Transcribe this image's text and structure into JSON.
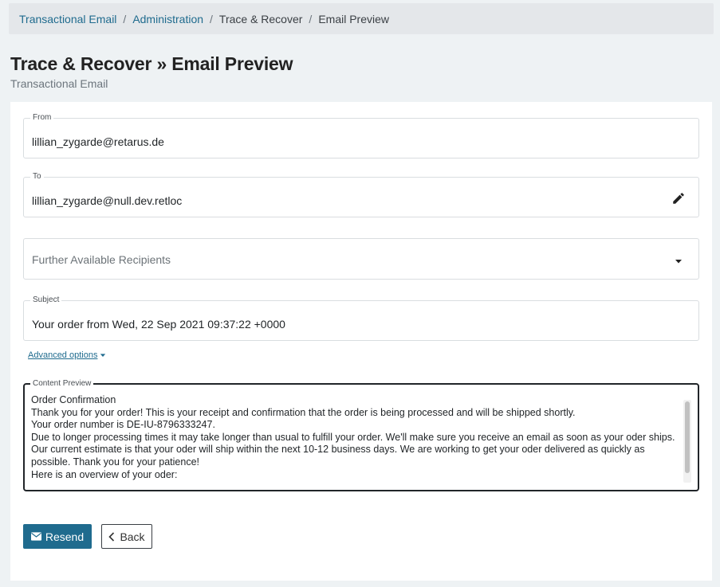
{
  "breadcrumb": {
    "items": [
      "Transactional Email",
      "Administration",
      "Trace & Recover",
      "Email Preview"
    ],
    "separator": "/"
  },
  "header": {
    "title": "Trace & Recover » Email Preview",
    "subtitle": "Transactional Email"
  },
  "form": {
    "from": {
      "label": "From",
      "value": "lillian_zygarde@retarus.de"
    },
    "to": {
      "label": "To",
      "value": "lillian_zygarde@null.dev.retloc",
      "edit_icon": "pencil-icon"
    },
    "recipients": {
      "placeholder": "Further Available Recipients",
      "icon": "caret-down-icon"
    },
    "subject": {
      "label": "Subject",
      "value": "Your order from Wed, 22 Sep 2021 09:37:22 +0000"
    },
    "advanced_options": "Advanced options",
    "content_preview": {
      "label": "Content Preview",
      "lines": [
        "Order Confirmation",
        "Thank you for your order! This is your receipt and confirmation that the order is being processed and will be shipped shortly.",
        "Your order number is DE-IU-8796333247.",
        "Due to longer processing times it may take longer than usual to fulfill your order. We'll make sure you receive an email as soon as your oder ships. Our current estimate is that your oder will ship within the next 10-12 business days. We are working to get your oder delivered as quickly as possible. Thank you for your patience!",
        "Here is an overview of your oder:"
      ]
    }
  },
  "actions": {
    "resend": "Resend",
    "back": "Back"
  },
  "colors": {
    "accent": "#1f6b8e",
    "background": "#eef2f4",
    "breadcrumb_bg": "#e4e7ea"
  }
}
